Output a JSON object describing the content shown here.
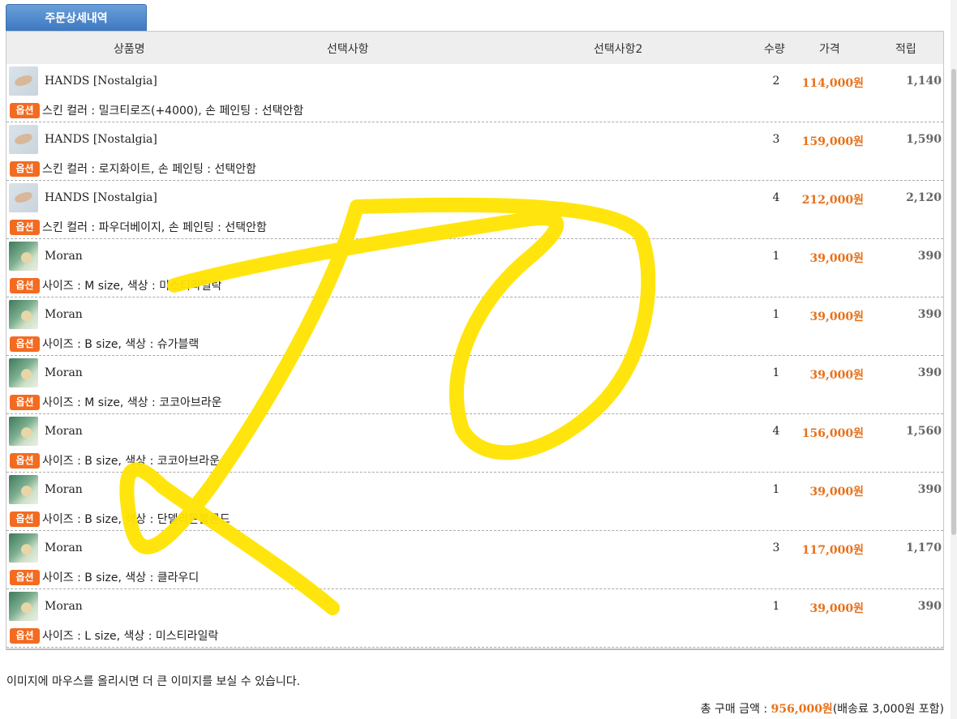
{
  "tab_label": "주문상세내역",
  "columns": {
    "product": "상품명",
    "option1": "선택사항",
    "option2": "선택사항2",
    "qty": "수량",
    "price": "가격",
    "points": "적립"
  },
  "option_badge": "옵션",
  "rows": [
    {
      "thumb": "hands",
      "name": "HANDS [Nostalgia]",
      "qty": "2",
      "price": "114,000원",
      "points": "1,140",
      "option": "스킨 컬러 : 밀크티로즈(+4000), 손 페인팅 : 선택안함"
    },
    {
      "thumb": "hands",
      "name": "HANDS [Nostalgia]",
      "qty": "3",
      "price": "159,000원",
      "points": "1,590",
      "option": "스킨 컬러 : 로지화이트, 손 페인팅 : 선택안함"
    },
    {
      "thumb": "hands",
      "name": "HANDS [Nostalgia]",
      "qty": "4",
      "price": "212,000원",
      "points": "2,120",
      "option": "스킨 컬러 : 파우더베이지, 손 페인팅 : 선택안함"
    },
    {
      "thumb": "moran",
      "name": "Moran",
      "qty": "1",
      "price": "39,000원",
      "points": "390",
      "option": "사이즈 : M size, 색상 : 미스티라일락"
    },
    {
      "thumb": "moran",
      "name": "Moran",
      "qty": "1",
      "price": "39,000원",
      "points": "390",
      "option": "사이즈 : B size, 색상 : 슈가블랙"
    },
    {
      "thumb": "moran",
      "name": "Moran",
      "qty": "1",
      "price": "39,000원",
      "points": "390",
      "option": "사이즈 : M size, 색상 : 코코아브라운"
    },
    {
      "thumb": "moran",
      "name": "Moran",
      "qty": "4",
      "price": "156,000원",
      "points": "1,560",
      "option": "사이즈 : B size, 색상 : 코코아브라운"
    },
    {
      "thumb": "moran",
      "name": "Moran",
      "qty": "1",
      "price": "39,000원",
      "points": "390",
      "option": "사이즈 : B size, 색상 : 단델리온블론드"
    },
    {
      "thumb": "moran",
      "name": "Moran",
      "qty": "3",
      "price": "117,000원",
      "points": "1,170",
      "option": "사이즈 : B size, 색상 : 클라우디"
    },
    {
      "thumb": "moran",
      "name": "Moran",
      "qty": "1",
      "price": "39,000원",
      "points": "390",
      "option": "사이즈 : L size, 색상 : 미스티라일락"
    }
  ],
  "hint_text": "이미지에 마우스를 올리시면 더 큰 이미지를 보실 수 있습니다.",
  "total": {
    "label": "총 구매 금액 : ",
    "amount": "956,000원",
    "shipping_note": "(배송료 3,000원 포함)"
  },
  "colors": {
    "accent_price": "#e8711a",
    "badge": "#f36b21",
    "tab": "#4a82c8",
    "scribble": "#ffe400"
  }
}
